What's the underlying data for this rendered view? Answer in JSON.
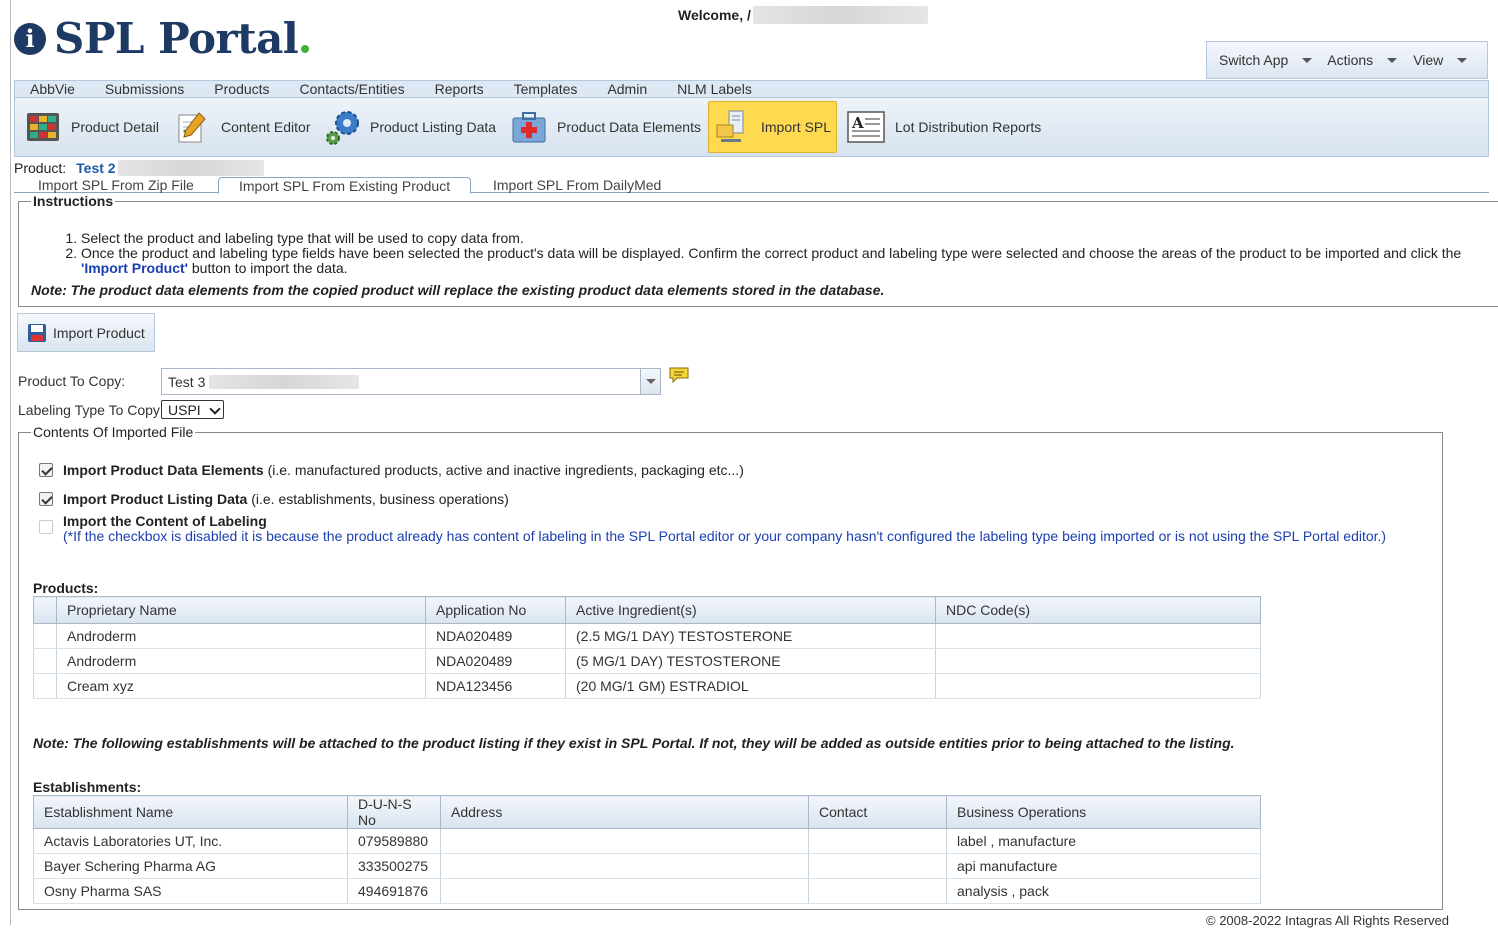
{
  "header": {
    "logo_text": "SPL Portal",
    "logo_badge": "i",
    "welcome": "Welcome, /"
  },
  "app_menu": [
    {
      "label": "Switch App"
    },
    {
      "label": "Actions"
    },
    {
      "label": "View"
    }
  ],
  "main_nav": [
    "AbbVie",
    "Submissions",
    "Products",
    "Contacts/Entities",
    "Reports",
    "Templates",
    "Admin",
    "NLM Labels"
  ],
  "toolbar": {
    "items": [
      {
        "label": "Product Detail",
        "icon": "grid-icon"
      },
      {
        "label": "Content Editor",
        "icon": "pencil-icon"
      },
      {
        "label": "Product Listing Data",
        "icon": "gear-icon"
      },
      {
        "label": "Product Data Elements",
        "icon": "medical-kit-icon"
      },
      {
        "label": "Import SPL",
        "icon": "import-computer-icon",
        "active": true
      },
      {
        "label": "Lot Distribution Reports",
        "icon": "document-icon"
      }
    ]
  },
  "product": {
    "label": "Product:",
    "value": "Test 2"
  },
  "tabs": [
    {
      "label": "Import SPL From Zip File"
    },
    {
      "label": "Import SPL From Existing Product",
      "active": true
    },
    {
      "label": "Import SPL From DailyMed"
    }
  ],
  "instructions": {
    "legend": "Instructions",
    "step1": "Select the product and labeling type that will be used to copy data from.",
    "step2_before": "Once the product and labeling type fields have been selected the product's data will be displayed. Confirm the correct product and labeling type were selected and choose the areas of the product to be imported and click the ",
    "step2_link": "'Import Product'",
    "step2_after": " button to import the data.",
    "note": "Note: The product data elements from the copied product will replace the existing product data elements stored in the database."
  },
  "import_button": "Import Product",
  "product_to_copy": {
    "label": "Product To Copy:",
    "value": "Test 3"
  },
  "labeling_type": {
    "label": "Labeling Type To Copy",
    "value": "USPI"
  },
  "contents": {
    "legend": "Contents Of Imported File",
    "opt1_bold": "Import Product Data Elements",
    "opt1_rest": " (i.e. manufactured products, active and inactive ingredients, packaging etc...)",
    "opt2_bold": "Import Product Listing Data",
    "opt2_rest": " (i.e. establishments, business operations)",
    "opt3_bold": "Import the Content of Labeling",
    "opt3_note": "(*If the checkbox is disabled it is because the product already has content of labeling in the SPL Portal editor or your company hasn't configured the labeling type being imported or is not using the SPL Portal editor.)"
  },
  "products": {
    "title": "Products:",
    "headers": [
      "Proprietary Name",
      "Application No",
      "Active Ingredient(s)",
      "NDC Code(s)"
    ],
    "rows": [
      [
        "Androderm",
        "NDA020489",
        "(2.5 MG/1 DAY) TESTOSTERONE",
        ""
      ],
      [
        "Androderm",
        "NDA020489",
        "(5 MG/1 DAY) TESTOSTERONE",
        ""
      ],
      [
        "Cream xyz",
        "NDA123456",
        "(20 MG/1 GM) ESTRADIOL",
        ""
      ]
    ]
  },
  "establishment_note": "Note: The following establishments will be attached to the product listing if they exist in SPL Portal. If not, they will be added as outside entities prior to being attached to the listing.",
  "establishments": {
    "title": "Establishments:",
    "headers": [
      "Establishment Name",
      "D-U-N-S No",
      "Address",
      "Contact",
      "Business Operations"
    ],
    "rows": [
      [
        "Actavis Laboratories UT, Inc.",
        "079589880",
        "",
        "",
        "label , manufacture"
      ],
      [
        "Bayer Schering Pharma AG",
        "333500275",
        "",
        "",
        "api manufacture"
      ],
      [
        "Osny Pharma SAS",
        "494691876",
        "",
        "",
        "analysis , pack"
      ]
    ]
  },
  "footer": "© 2008-2022 Intagras All Rights Reserved"
}
